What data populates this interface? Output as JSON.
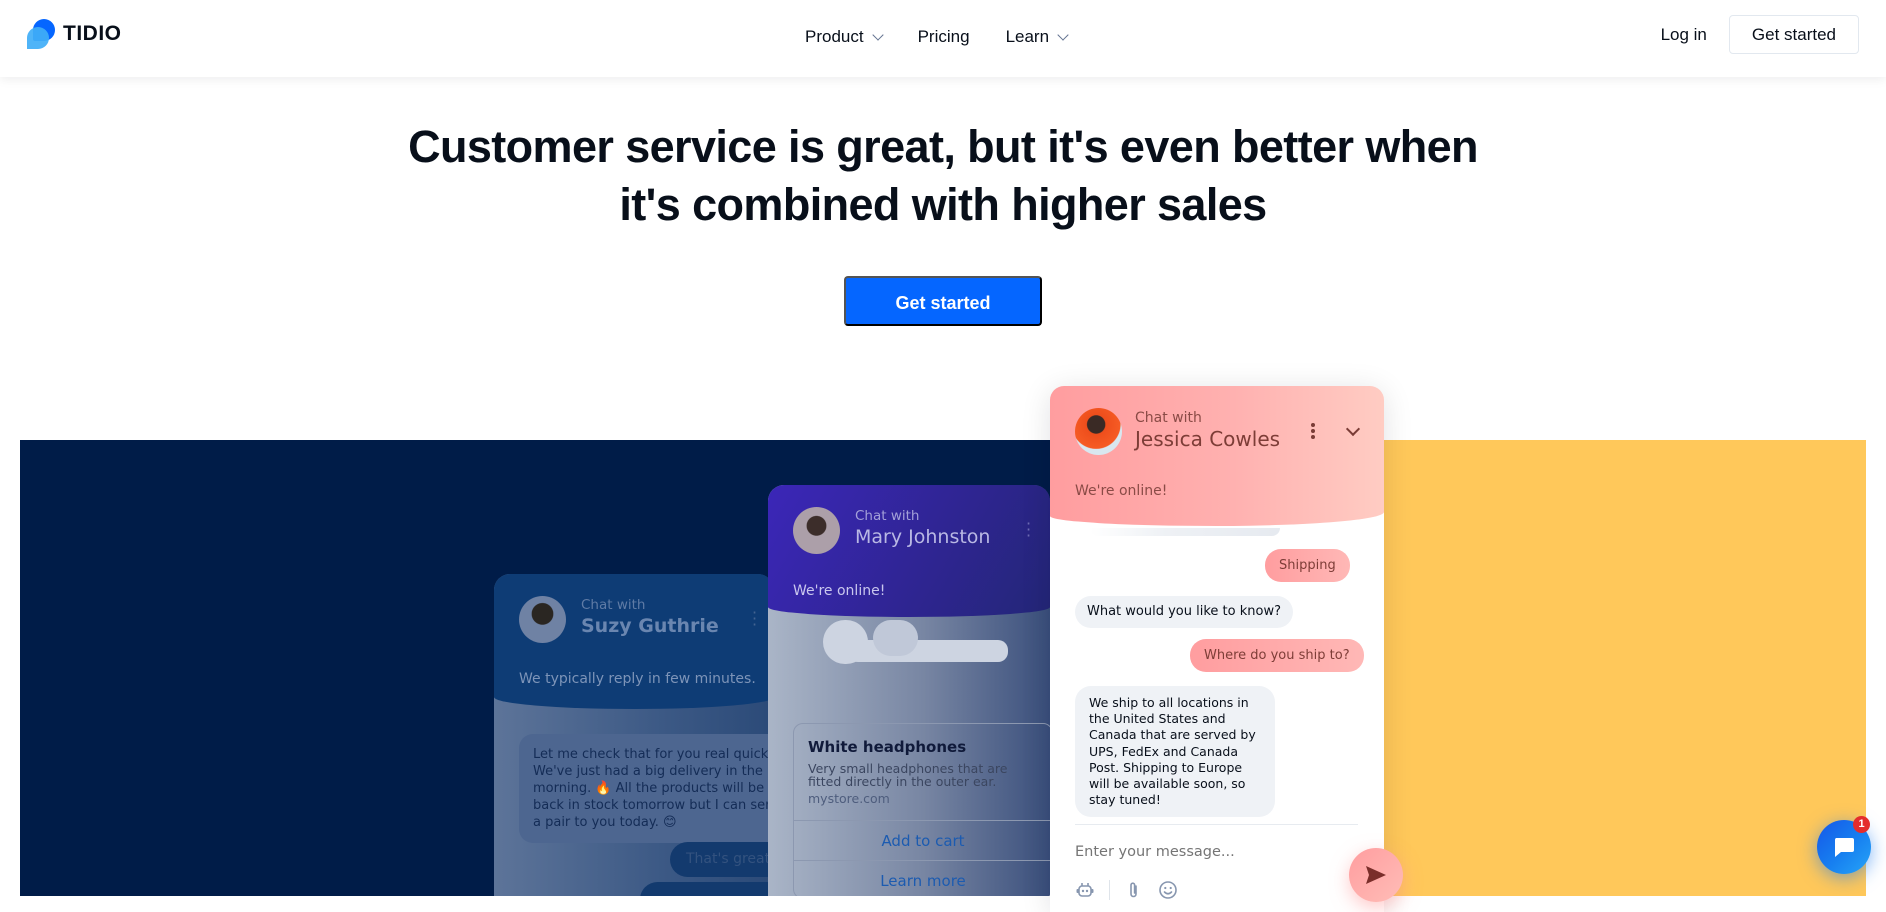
{
  "nav": {
    "brand": "TIDIO",
    "items": [
      {
        "label": "Product",
        "has_dropdown": true
      },
      {
        "label": "Pricing",
        "has_dropdown": false
      },
      {
        "label": "Learn",
        "has_dropdown": true
      }
    ],
    "login_label": "Log in",
    "cta_label": "Get started"
  },
  "hero": {
    "headline_part1": "Customer service is great, but it's ",
    "headline_bold": "even better",
    "headline_part2": " when",
    "headline_line2": "it's combined with higher sales",
    "cta_label": "Get started"
  },
  "colors": {
    "brand_blue": "#0566ff",
    "navy_panel": "#001c48",
    "yellow_panel": "#ffc85a",
    "coral": "#ff9d9f"
  },
  "cards": {
    "suzy": {
      "chat_with": "Chat with",
      "name": "Suzy Guthrie",
      "status": "We typically reply in few minutes.",
      "message": "Let me check that for you real quick! We've just had a big delivery in the morning. 🔥 All the products will be back in stock tomorrow but I can send a pair to you today. 😊",
      "reply": "That's great"
    },
    "mary": {
      "chat_with": "Chat with",
      "name": "Mary Johnston",
      "status": "We're online!",
      "product_name": "White headphones",
      "product_desc": "Very small headphones that are fitted directly in the outer ear.",
      "product_url": "mystore.com",
      "add_to_cart": "Add to cart",
      "learn_more": "Learn more"
    },
    "jessica": {
      "chat_with": "Chat with",
      "name": "Jessica Cowles",
      "status": "We're online!",
      "messages": [
        {
          "from": "visitor",
          "text": "Shipping"
        },
        {
          "from": "agent",
          "text": "What would you like to know?"
        },
        {
          "from": "visitor",
          "text": "Where do you ship to?"
        },
        {
          "from": "agent",
          "text": "We ship to all locations in the United States and Canada that are served by UPS, FedEx and Canada Post. Shipping to Europe will be available soon, so stay tuned!"
        }
      ],
      "input_placeholder": "Enter your message..."
    }
  },
  "widget": {
    "unread_count": "1"
  }
}
